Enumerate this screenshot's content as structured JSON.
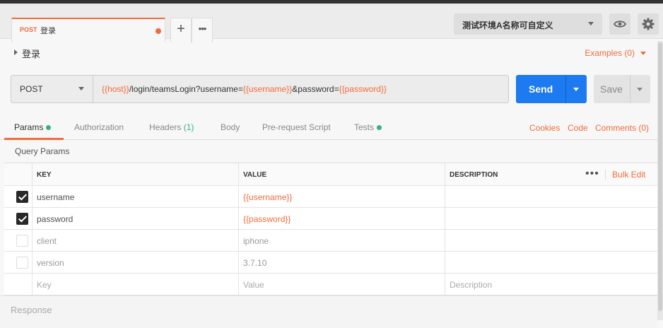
{
  "tab": {
    "method": "POST",
    "name": "登录"
  },
  "tab_buttons": {
    "new_label": "+",
    "more_label": "•••"
  },
  "environment": {
    "selected": "测试环境A名称可自定义"
  },
  "request": {
    "title": "登录",
    "examples_label": "Examples (0)",
    "method": "POST",
    "url_parts": [
      {
        "text": "{{host}}",
        "is_var": true
      },
      {
        "text": "/login/teamsLogin?username=",
        "is_var": false
      },
      {
        "text": "{{username}}",
        "is_var": true
      },
      {
        "text": "&password=",
        "is_var": false
      },
      {
        "text": "{{password}}",
        "is_var": true
      }
    ],
    "send_label": "Send",
    "save_label": "Save"
  },
  "request_tabs": [
    {
      "label": "Params",
      "active": true,
      "dot": true
    },
    {
      "label": "Authorization"
    },
    {
      "label": "Headers",
      "count": "(1)"
    },
    {
      "label": "Body"
    },
    {
      "label": "Pre-request Script"
    },
    {
      "label": "Tests",
      "dot": true
    }
  ],
  "right_links": {
    "cookies": "Cookies",
    "code": "Code",
    "comments": "Comments (0)"
  },
  "params": {
    "section_label": "Query Params",
    "headers": {
      "key": "KEY",
      "value": "VALUE",
      "description": "DESCRIPTION"
    },
    "more_label": "•••",
    "bulk_edit": "Bulk Edit",
    "rows": [
      {
        "key": "username",
        "value": "{{username}}",
        "description": "",
        "checked": true
      },
      {
        "key": "password",
        "value": "{{password}}",
        "description": "",
        "checked": true
      },
      {
        "key": "client",
        "value": "iphone",
        "description": "",
        "checked": false
      },
      {
        "key": "version",
        "value": "3.7.10",
        "description": "",
        "checked": false
      }
    ],
    "placeholder_row": {
      "key": "Key",
      "value": "Value",
      "description": "Description"
    }
  },
  "response": {
    "label": "Response"
  },
  "colors": {
    "accent": "#f26b3a",
    "send": "#1d7af0",
    "status_green": "#2eb67d"
  }
}
